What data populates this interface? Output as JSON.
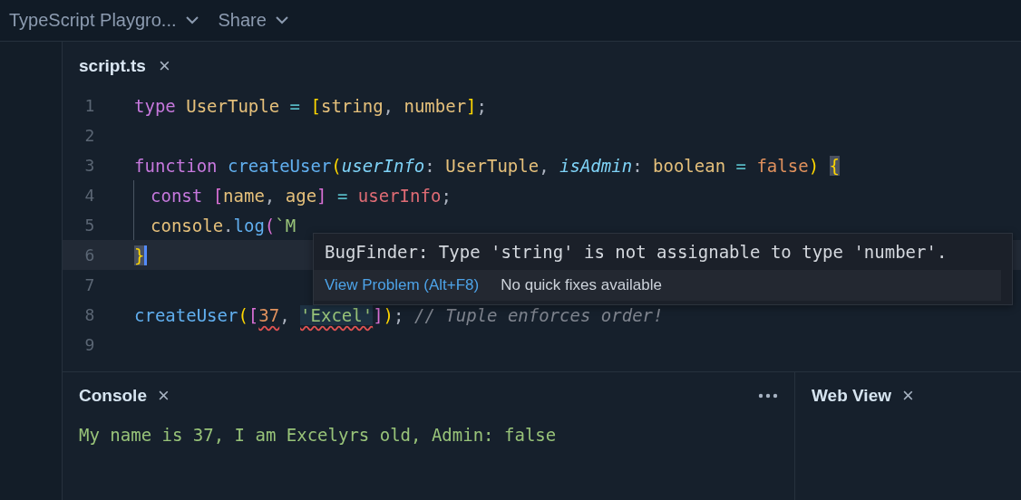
{
  "topbar": {
    "items": [
      {
        "label": "TypeScript Playgro..."
      },
      {
        "label": "Share"
      }
    ]
  },
  "editor": {
    "tab": {
      "label": "script.ts",
      "close": "×"
    },
    "lines": [
      {
        "number": "1",
        "current": false,
        "indent": false,
        "tokens": [
          {
            "text": "type ",
            "kind": "keyword"
          },
          {
            "text": "UserTuple",
            "kind": "type"
          },
          {
            "text": " = ",
            "kind": "operator"
          },
          {
            "text": "[",
            "kind": "bracket1"
          },
          {
            "text": "string",
            "kind": "type"
          },
          {
            "text": ", ",
            "kind": "plain"
          },
          {
            "text": "number",
            "kind": "type"
          },
          {
            "text": "]",
            "kind": "bracket1"
          },
          {
            "text": ";",
            "kind": "plain"
          }
        ]
      },
      {
        "number": "2",
        "current": false,
        "indent": false
      },
      {
        "number": "3",
        "current": false,
        "indent": false,
        "tokens": [
          {
            "text": "function ",
            "kind": "keyword"
          },
          {
            "text": "createUser",
            "kind": "func"
          },
          {
            "text": "(",
            "kind": "bracket1"
          },
          {
            "text": "userInfo",
            "kind": "param"
          },
          {
            "text": ": ",
            "kind": "plain"
          },
          {
            "text": "UserTuple",
            "kind": "type"
          },
          {
            "text": ", ",
            "kind": "plain"
          },
          {
            "text": "isAdmin",
            "kind": "param"
          },
          {
            "text": ": ",
            "kind": "plain"
          },
          {
            "text": "boolean",
            "kind": "type"
          },
          {
            "text": " = ",
            "kind": "operator"
          },
          {
            "text": "false",
            "kind": "number"
          },
          {
            "text": ") ",
            "kind": "bracket1"
          },
          {
            "text": "{",
            "kind": "bracket1",
            "matched": true
          }
        ]
      },
      {
        "number": "4",
        "current": false,
        "indent": true,
        "tokens": [
          {
            "text": "const ",
            "kind": "keyword"
          },
          {
            "text": "[",
            "kind": "bracket2"
          },
          {
            "text": "name",
            "kind": "type"
          },
          {
            "text": ", ",
            "kind": "plain"
          },
          {
            "text": "age",
            "kind": "type"
          },
          {
            "text": "]",
            "kind": "bracket2"
          },
          {
            "text": " = ",
            "kind": "operator"
          },
          {
            "text": "userInfo",
            "kind": "var"
          },
          {
            "text": ";",
            "kind": "plain"
          }
        ]
      },
      {
        "number": "5",
        "current": false,
        "indent": true,
        "tokens": [
          {
            "text": "console",
            "kind": "type"
          },
          {
            "text": ".",
            "kind": "plain"
          },
          {
            "text": "log",
            "kind": "func"
          },
          {
            "text": "(",
            "kind": "bracket2"
          },
          {
            "text": "`M",
            "kind": "string"
          }
        ]
      },
      {
        "number": "6",
        "current": true,
        "indent": false,
        "tokens": [
          {
            "text": "}",
            "kind": "bracket1",
            "matched": true
          }
        ]
      },
      {
        "number": "7",
        "current": false,
        "indent": false
      },
      {
        "number": "8",
        "current": false,
        "indent": false,
        "tokens": [
          {
            "text": "createUser",
            "kind": "func"
          },
          {
            "text": "(",
            "kind": "bracket1"
          },
          {
            "text": "[",
            "kind": "bracket2"
          },
          {
            "text": "37",
            "kind": "number",
            "error": true
          },
          {
            "text": ", ",
            "kind": "plain"
          },
          {
            "text": "'Excel'",
            "kind": "string",
            "error": true,
            "selected": true
          },
          {
            "text": "]",
            "kind": "bracket2"
          },
          {
            "text": ")",
            "kind": "bracket1"
          },
          {
            "text": "; ",
            "kind": "plain"
          },
          {
            "text": "// Tuple enforces order!",
            "kind": "comment"
          }
        ]
      },
      {
        "number": "9",
        "current": false,
        "indent": false
      }
    ]
  },
  "tooltip": {
    "message": "BugFinder: Type 'string' is not assignable to type 'number'.",
    "link": "View Problem (Alt+F8)",
    "note": "No quick fixes available"
  },
  "console": {
    "title": "Console",
    "close": "×",
    "output": "My name is 37, I am Excelyrs old, Admin: false"
  },
  "webview": {
    "title": "Web View",
    "close": "×"
  }
}
